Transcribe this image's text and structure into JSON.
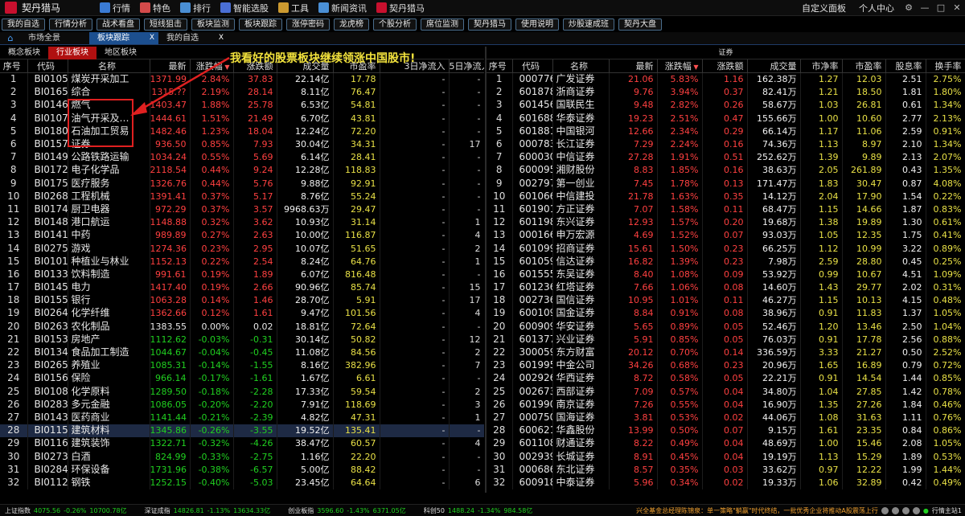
{
  "app": {
    "title": "契丹猎马"
  },
  "titlebar": {
    "nav": [
      {
        "label": "行情",
        "icon": "quotes-icon",
        "color": "#3a7bd5"
      },
      {
        "label": "特色",
        "icon": "feature-icon",
        "color": "#d34a4a"
      },
      {
        "label": "排行",
        "icon": "ranking-icon",
        "color": "#4a8fd5"
      },
      {
        "label": "智能选股",
        "icon": "smart-select-icon",
        "color": "#4a6fd5"
      },
      {
        "label": "工具",
        "icon": "tools-icon",
        "color": "#cc9a30"
      },
      {
        "label": "新闻资讯",
        "icon": "news-icon",
        "color": "#4a8fd5"
      },
      {
        "label": "契丹猎马",
        "icon": "brand-icon",
        "color": "#c8102e"
      }
    ],
    "right": {
      "custom": "自定义面板",
      "personal": "个人中心"
    }
  },
  "toolbar": [
    "我的自选",
    "行情分析",
    "战术看盘",
    "短线狙击",
    "板块监测",
    "板块跟踪",
    "涨停密码",
    "龙虎榜",
    "个股分析",
    "席位监测",
    "契丹猎马",
    "使用说明",
    "炒股速成班",
    "契丹大盘"
  ],
  "tabs": [
    {
      "label": "市场全景",
      "active": false,
      "close": false
    },
    {
      "label": "板块跟踪",
      "active": true,
      "close": true
    },
    {
      "label": "我的自选",
      "active": false,
      "close": true
    }
  ],
  "left": {
    "subtabs": [
      "概念板块",
      "行业板块",
      "地区板块"
    ],
    "active_subtab": 1,
    "headers": [
      "序号",
      "代码",
      "名称",
      "最新",
      "涨跌幅",
      "涨跌额",
      "成交量",
      "市盈率",
      "3日净流入",
      "5日净流入"
    ],
    "rows": [
      [
        "1",
        "BI0105",
        "煤炭开采加工",
        "1371.99",
        "2.84%",
        "37.83",
        "22.14亿",
        "17.78",
        "-",
        "-"
      ],
      [
        "2",
        "BI0165",
        "综合",
        "1315.??",
        "2.19%",
        "28.14",
        "8.11亿",
        "76.47",
        "-",
        "-"
      ],
      [
        "3",
        "BI0146",
        "燃气",
        "1403.47",
        "1.88%",
        "25.78",
        "6.53亿",
        "54.81",
        "-",
        "-"
      ],
      [
        "4",
        "BI0107",
        "油气开采及…",
        "1444.61",
        "1.51%",
        "21.49",
        "6.70亿",
        "43.81",
        "-",
        "-"
      ],
      [
        "5",
        "BI0180",
        "石油加工贸易",
        "1482.46",
        "1.23%",
        "18.04",
        "12.24亿",
        "72.20",
        "-",
        "-"
      ],
      [
        "6",
        "BI0157",
        "证券",
        "936.50",
        "0.85%",
        "7.93",
        "30.04亿",
        "34.31",
        "-",
        "17"
      ],
      [
        "7",
        "BI0149",
        "公路铁路运输",
        "1034.24",
        "0.55%",
        "5.69",
        "6.14亿",
        "28.41",
        "-",
        "-"
      ],
      [
        "8",
        "BI0172",
        "电子化学品",
        "2118.54",
        "0.44%",
        "9.24",
        "12.28亿",
        "118.83",
        "-",
        "-"
      ],
      [
        "9",
        "BI0175",
        "医疗服务",
        "1326.76",
        "0.44%",
        "5.76",
        "9.88亿",
        "92.91",
        "-",
        "-"
      ],
      [
        "10",
        "BI0268",
        "工程机械",
        "1391.41",
        "0.37%",
        "5.17",
        "8.76亿",
        "55.24",
        "-",
        "-"
      ],
      [
        "11",
        "BI0174",
        "厨卫电器",
        "972.29",
        "0.37%",
        "3.57",
        "9968.63万",
        "29.47",
        "-",
        "-"
      ],
      [
        "12",
        "BI0148",
        "港口航运",
        "1148.88",
        "0.32%",
        "3.62",
        "10.93亿",
        "31.14",
        "-",
        "1"
      ],
      [
        "13",
        "BI0141",
        "中药",
        "989.89",
        "0.27%",
        "2.63",
        "10.00亿",
        "116.87",
        "-",
        "4"
      ],
      [
        "14",
        "BI0275",
        "游戏",
        "1274.36",
        "0.23%",
        "2.95",
        "10.07亿",
        "51.65",
        "-",
        "2"
      ],
      [
        "15",
        "BI0101",
        "种植业与林业",
        "1152.13",
        "0.22%",
        "2.54",
        "8.24亿",
        "64.76",
        "-",
        "1"
      ],
      [
        "16",
        "BI0133",
        "饮料制造",
        "991.61",
        "0.19%",
        "1.89",
        "6.07亿",
        "816.48",
        "-",
        "-"
      ],
      [
        "17",
        "BI0145",
        "电力",
        "1417.40",
        "0.19%",
        "2.66",
        "90.96亿",
        "85.74",
        "-",
        "15"
      ],
      [
        "18",
        "BI0155",
        "银行",
        "1063.28",
        "0.14%",
        "1.46",
        "28.70亿",
        "5.91",
        "-",
        "17"
      ],
      [
        "19",
        "BI0264",
        "化学纤维",
        "1362.66",
        "0.12%",
        "1.61",
        "9.47亿",
        "101.56",
        "-",
        "4"
      ],
      [
        "20",
        "BI0263",
        "农化制品",
        "1383.55",
        "0.00%",
        "0.02",
        "18.81亿",
        "72.64",
        "-",
        "-"
      ],
      [
        "21",
        "BI0153",
        "房地产",
        "1112.62",
        "-0.03%",
        "-0.31",
        "30.14亿",
        "50.82",
        "-",
        "12"
      ],
      [
        "22",
        "BI0134",
        "食品加工制造",
        "1044.67",
        "-0.04%",
        "-0.45",
        "11.08亿",
        "84.56",
        "-",
        "2"
      ],
      [
        "23",
        "BI0265",
        "养殖业",
        "1085.31",
        "-0.14%",
        "-1.55",
        "8.16亿",
        "382.96",
        "-",
        "7"
      ],
      [
        "24",
        "BI0156",
        "保险",
        "966.14",
        "-0.17%",
        "-1.61",
        "1.67亿",
        "6.61",
        "-",
        "-"
      ],
      [
        "25",
        "BI0108",
        "化学原料",
        "1289.50",
        "-0.18%",
        "-2.28",
        "17.33亿",
        "59.54",
        "-",
        "2"
      ],
      [
        "26",
        "BI0283",
        "多元金融",
        "1086.05",
        "-0.20%",
        "-2.20",
        "7.91亿",
        "118.69",
        "-",
        "3"
      ],
      [
        "27",
        "BI0143",
        "医药商业",
        "1141.44",
        "-0.21%",
        "-2.39",
        "4.82亿",
        "47.31",
        "-",
        "1"
      ],
      [
        "28",
        "BI0115",
        "建筑材料",
        "1345.86",
        "-0.26%",
        "-3.55",
        "19.52亿",
        "135.41",
        "-",
        "-"
      ],
      [
        "29",
        "BI0116",
        "建筑装饰",
        "1322.71",
        "-0.32%",
        "-4.26",
        "38.47亿",
        "60.57",
        "-",
        "4"
      ],
      [
        "30",
        "BI0273",
        "白酒",
        "824.99",
        "-0.33%",
        "-2.75",
        "1.16亿",
        "22.20",
        "-",
        "-"
      ],
      [
        "31",
        "BI0284",
        "环保设备",
        "1731.96",
        "-0.38%",
        "-6.57",
        "5.00亿",
        "88.42",
        "-",
        "-"
      ],
      [
        "32",
        "BI0112",
        "钢铁",
        "1252.15",
        "-0.40%",
        "-5.03",
        "23.45亿",
        "64.64",
        "-",
        "6"
      ]
    ],
    "selected_row": 27
  },
  "right": {
    "title": "证券",
    "headers": [
      "序号",
      "代码",
      "名称",
      "最新",
      "涨跌幅",
      "涨跌额",
      "成交量",
      "市净率",
      "市盈率",
      "股息率",
      "换手率"
    ],
    "rows": [
      [
        "1",
        "000776",
        "广发证券",
        "21.06",
        "5.83%",
        "1.16",
        "162.38万",
        "1.27",
        "12.03",
        "2.51",
        "2.75%"
      ],
      [
        "2",
        "601878",
        "浙商证券",
        "9.76",
        "3.94%",
        "0.37",
        "82.41万",
        "1.21",
        "18.50",
        "1.81",
        "1.80%"
      ],
      [
        "3",
        "601456",
        "国联民生",
        "9.48",
        "2.82%",
        "0.26",
        "58.67万",
        "1.03",
        "26.81",
        "0.61",
        "1.34%"
      ],
      [
        "4",
        "601688",
        "华泰证券",
        "19.23",
        "2.51%",
        "0.47",
        "155.66万",
        "1.00",
        "10.60",
        "2.77",
        "2.13%"
      ],
      [
        "5",
        "601881",
        "中国银河",
        "12.66",
        "2.34%",
        "0.29",
        "66.14万",
        "1.17",
        "11.06",
        "2.59",
        "0.91%"
      ],
      [
        "6",
        "000783",
        "长江证券",
        "7.29",
        "2.24%",
        "0.16",
        "74.36万",
        "1.13",
        "8.97",
        "2.10",
        "1.34%"
      ],
      [
        "7",
        "600030",
        "中信证券",
        "27.28",
        "1.91%",
        "0.51",
        "252.62万",
        "1.39",
        "9.89",
        "2.13",
        "2.07%"
      ],
      [
        "8",
        "600095",
        "湘财股份",
        "8.83",
        "1.85%",
        "0.16",
        "38.63万",
        "2.05",
        "261.89",
        "0.43",
        "1.35%"
      ],
      [
        "9",
        "002797",
        "第一创业",
        "7.45",
        "1.78%",
        "0.13",
        "171.47万",
        "1.83",
        "30.47",
        "0.87",
        "4.08%"
      ],
      [
        "10",
        "601066",
        "中信建投",
        "21.78",
        "1.63%",
        "0.35",
        "14.12万",
        "2.04",
        "17.90",
        "1.54",
        "0.22%"
      ],
      [
        "11",
        "601901",
        "方正证券",
        "7.07",
        "1.58%",
        "0.11",
        "68.47万",
        "1.15",
        "14.66",
        "1.87",
        "0.83%"
      ],
      [
        "12",
        "601198",
        "东兴证券",
        "12.93",
        "1.57%",
        "0.20",
        "19.68万",
        "1.38",
        "19.89",
        "1.30",
        "0.61%"
      ],
      [
        "13",
        "000166",
        "申万宏源",
        "4.69",
        "1.52%",
        "0.07",
        "93.03万",
        "1.05",
        "12.35",
        "1.75",
        "0.41%"
      ],
      [
        "14",
        "601099",
        "招商证券",
        "15.61",
        "1.50%",
        "0.23",
        "66.25万",
        "1.12",
        "10.99",
        "3.22",
        "0.89%"
      ],
      [
        "15",
        "601059",
        "信达证券",
        "16.82",
        "1.39%",
        "0.23",
        "7.98万",
        "2.59",
        "28.80",
        "0.45",
        "0.25%"
      ],
      [
        "16",
        "601555",
        "东吴证券",
        "8.40",
        "1.08%",
        "0.09",
        "53.92万",
        "0.99",
        "10.67",
        "4.51",
        "1.09%"
      ],
      [
        "17",
        "601236",
        "红塔证券",
        "7.66",
        "1.06%",
        "0.08",
        "14.60万",
        "1.43",
        "29.77",
        "2.02",
        "0.31%"
      ],
      [
        "18",
        "002736",
        "国信证券",
        "10.95",
        "1.01%",
        "0.11",
        "46.27万",
        "1.15",
        "10.13",
        "4.15",
        "0.48%"
      ],
      [
        "19",
        "600109",
        "国金证券",
        "8.84",
        "0.91%",
        "0.08",
        "38.96万",
        "0.91",
        "11.83",
        "1.37",
        "1.05%"
      ],
      [
        "20",
        "600909",
        "华安证券",
        "5.65",
        "0.89%",
        "0.05",
        "52.46万",
        "1.20",
        "13.46",
        "2.50",
        "1.04%"
      ],
      [
        "21",
        "601377",
        "兴业证券",
        "5.91",
        "0.85%",
        "0.05",
        "76.03万",
        "0.91",
        "17.78",
        "2.56",
        "0.88%"
      ],
      [
        "22",
        "300059",
        "东方财富",
        "20.12",
        "0.70%",
        "0.14",
        "336.59万",
        "3.33",
        "21.27",
        "0.50",
        "2.52%"
      ],
      [
        "23",
        "601995",
        "中金公司",
        "34.26",
        "0.68%",
        "0.23",
        "20.96万",
        "1.65",
        "16.89",
        "0.79",
        "0.72%"
      ],
      [
        "24",
        "002926",
        "华西证券",
        "8.72",
        "0.58%",
        "0.05",
        "22.21万",
        "0.91",
        "14.54",
        "1.44",
        "0.85%"
      ],
      [
        "25",
        "002673",
        "西部证券",
        "7.09",
        "0.57%",
        "0.04",
        "34.80万",
        "1.04",
        "27.85",
        "1.42",
        "0.78%"
      ],
      [
        "26",
        "601990",
        "南京证券",
        "7.26",
        "0.55%",
        "0.04",
        "16.90万",
        "1.35",
        "27.26",
        "1.84",
        "0.46%"
      ],
      [
        "27",
        "000750",
        "国海证券",
        "3.81",
        "0.53%",
        "0.02",
        "44.06万",
        "1.08",
        "31.63",
        "1.11",
        "0.76%"
      ],
      [
        "28",
        "600621",
        "华鑫股份",
        "13.99",
        "0.50%",
        "0.07",
        "9.15万",
        "1.61",
        "23.35",
        "0.84",
        "0.86%"
      ],
      [
        "29",
        "601108",
        "财通证券",
        "8.22",
        "0.49%",
        "0.04",
        "48.69万",
        "1.00",
        "15.46",
        "2.08",
        "1.05%"
      ],
      [
        "30",
        "002939",
        "长城证券",
        "8.91",
        "0.45%",
        "0.04",
        "19.19万",
        "1.13",
        "15.29",
        "1.89",
        "0.53%"
      ],
      [
        "31",
        "000686",
        "东北证券",
        "8.57",
        "0.35%",
        "0.03",
        "33.62万",
        "0.97",
        "12.22",
        "1.99",
        "1.44%"
      ],
      [
        "32",
        "600918",
        "中泰证券",
        "5.96",
        "0.34%",
        "0.02",
        "19.33万",
        "1.06",
        "32.89",
        "0.42",
        "0.49%"
      ]
    ]
  },
  "annotation": {
    "text": "我看好的股票板块继续领涨中国股市!",
    "color": "#f2e23c"
  },
  "statusbar": {
    "indices": [
      {
        "name": "上证指数",
        "value": "4075.56",
        "change": "-0.26%",
        "amount": "10700.78亿"
      },
      {
        "name": "深证成指",
        "value": "14826.81",
        "change": "-1.13%",
        "amount": "13634.33亿"
      },
      {
        "name": "创业板指",
        "value": "3596.60",
        "change": "-1.43%",
        "amount": "6371.05亿"
      },
      {
        "name": "科创50",
        "value": "1488.24",
        "change": "-1.34%",
        "amount": "984.58亿"
      }
    ],
    "news": "兴全基金总经理陈锦泉：单一策略\"躺赢\"时代终结，一批优秀企业将推动A股震荡上行",
    "server": "行情主站1"
  },
  "colors": {
    "up": "#ff4040",
    "down": "#20d020",
    "flat": "#e8e8e8",
    "pe": "#e8e046",
    "accent": "#1c4f8f"
  }
}
